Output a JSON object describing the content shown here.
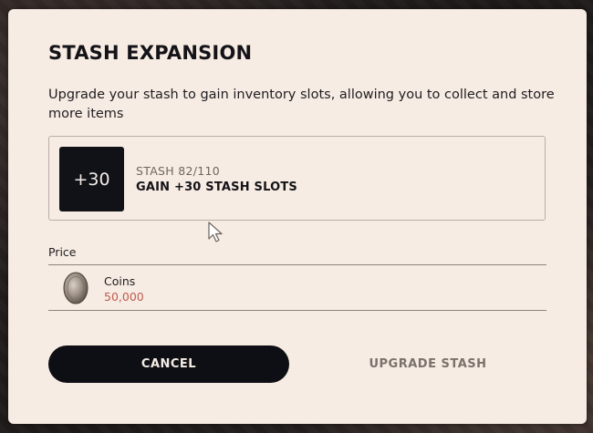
{
  "dialog": {
    "title": "STASH EXPANSION",
    "description": "Upgrade your stash to gain inventory slots, allowing you to collect and store more items"
  },
  "upgrade": {
    "badge": "+30",
    "stash_count": "STASH 82/110",
    "gain_text": "GAIN +30 STASH SLOTS"
  },
  "price": {
    "label": "Price",
    "currency_icon": "coin-icon",
    "currency_name": "Coins",
    "amount": "50,000",
    "amount_color": "#c05a50"
  },
  "actions": {
    "cancel_label": "CANCEL",
    "upgrade_label": "UPGRADE STASH"
  },
  "colors": {
    "dialog_bg": "#f7ece3",
    "primary_button": "#0e0f14",
    "disabled_text": "#7a716b"
  }
}
